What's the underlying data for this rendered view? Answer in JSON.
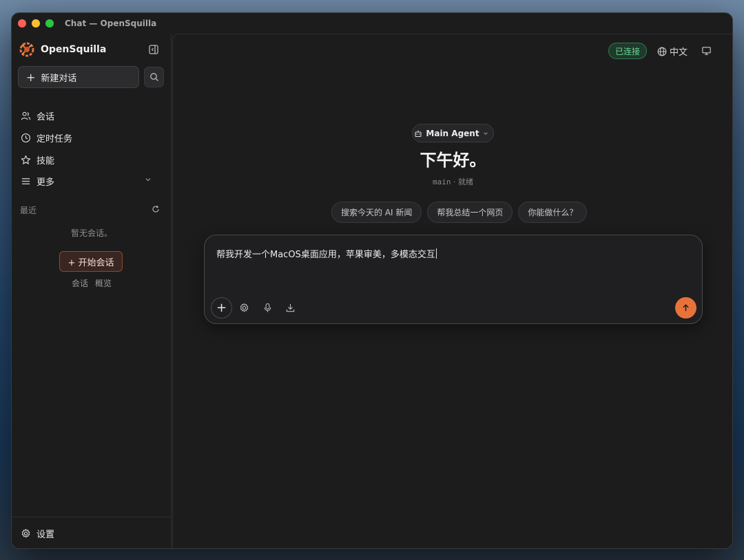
{
  "window": {
    "title": "Chat — OpenSquilla"
  },
  "sidebar": {
    "brand": "OpenSquilla",
    "new_chat_label": "新建对话",
    "nav": [
      {
        "label": "会话",
        "icon": "users-icon"
      },
      {
        "label": "定时任务",
        "icon": "clock-icon"
      },
      {
        "label": "技能",
        "icon": "star-icon"
      },
      {
        "label": "更多",
        "icon": "menu-icon"
      }
    ],
    "recent_label": "最近",
    "empty_text": "暂无会话。",
    "start_label": "+ 开始会话",
    "links": [
      "会话",
      "概览"
    ],
    "settings_label": "设置"
  },
  "header": {
    "status": "已连接",
    "language": "中文"
  },
  "main": {
    "agent_label": "Main Agent",
    "greeting": "下午好。",
    "status_name": "main",
    "status_sep": "·",
    "status_state": "就绪",
    "suggestions": [
      "搜索今天的 AI 新闻",
      "帮我总结一个网页",
      "你能做什么？"
    ],
    "composer_text": "帮我开发一个MacOS桌面应用，苹果审美，多模态交互"
  },
  "colors": {
    "accent": "#e8733a",
    "connected": "#6fd49a",
    "background": "#1c1c1d"
  }
}
